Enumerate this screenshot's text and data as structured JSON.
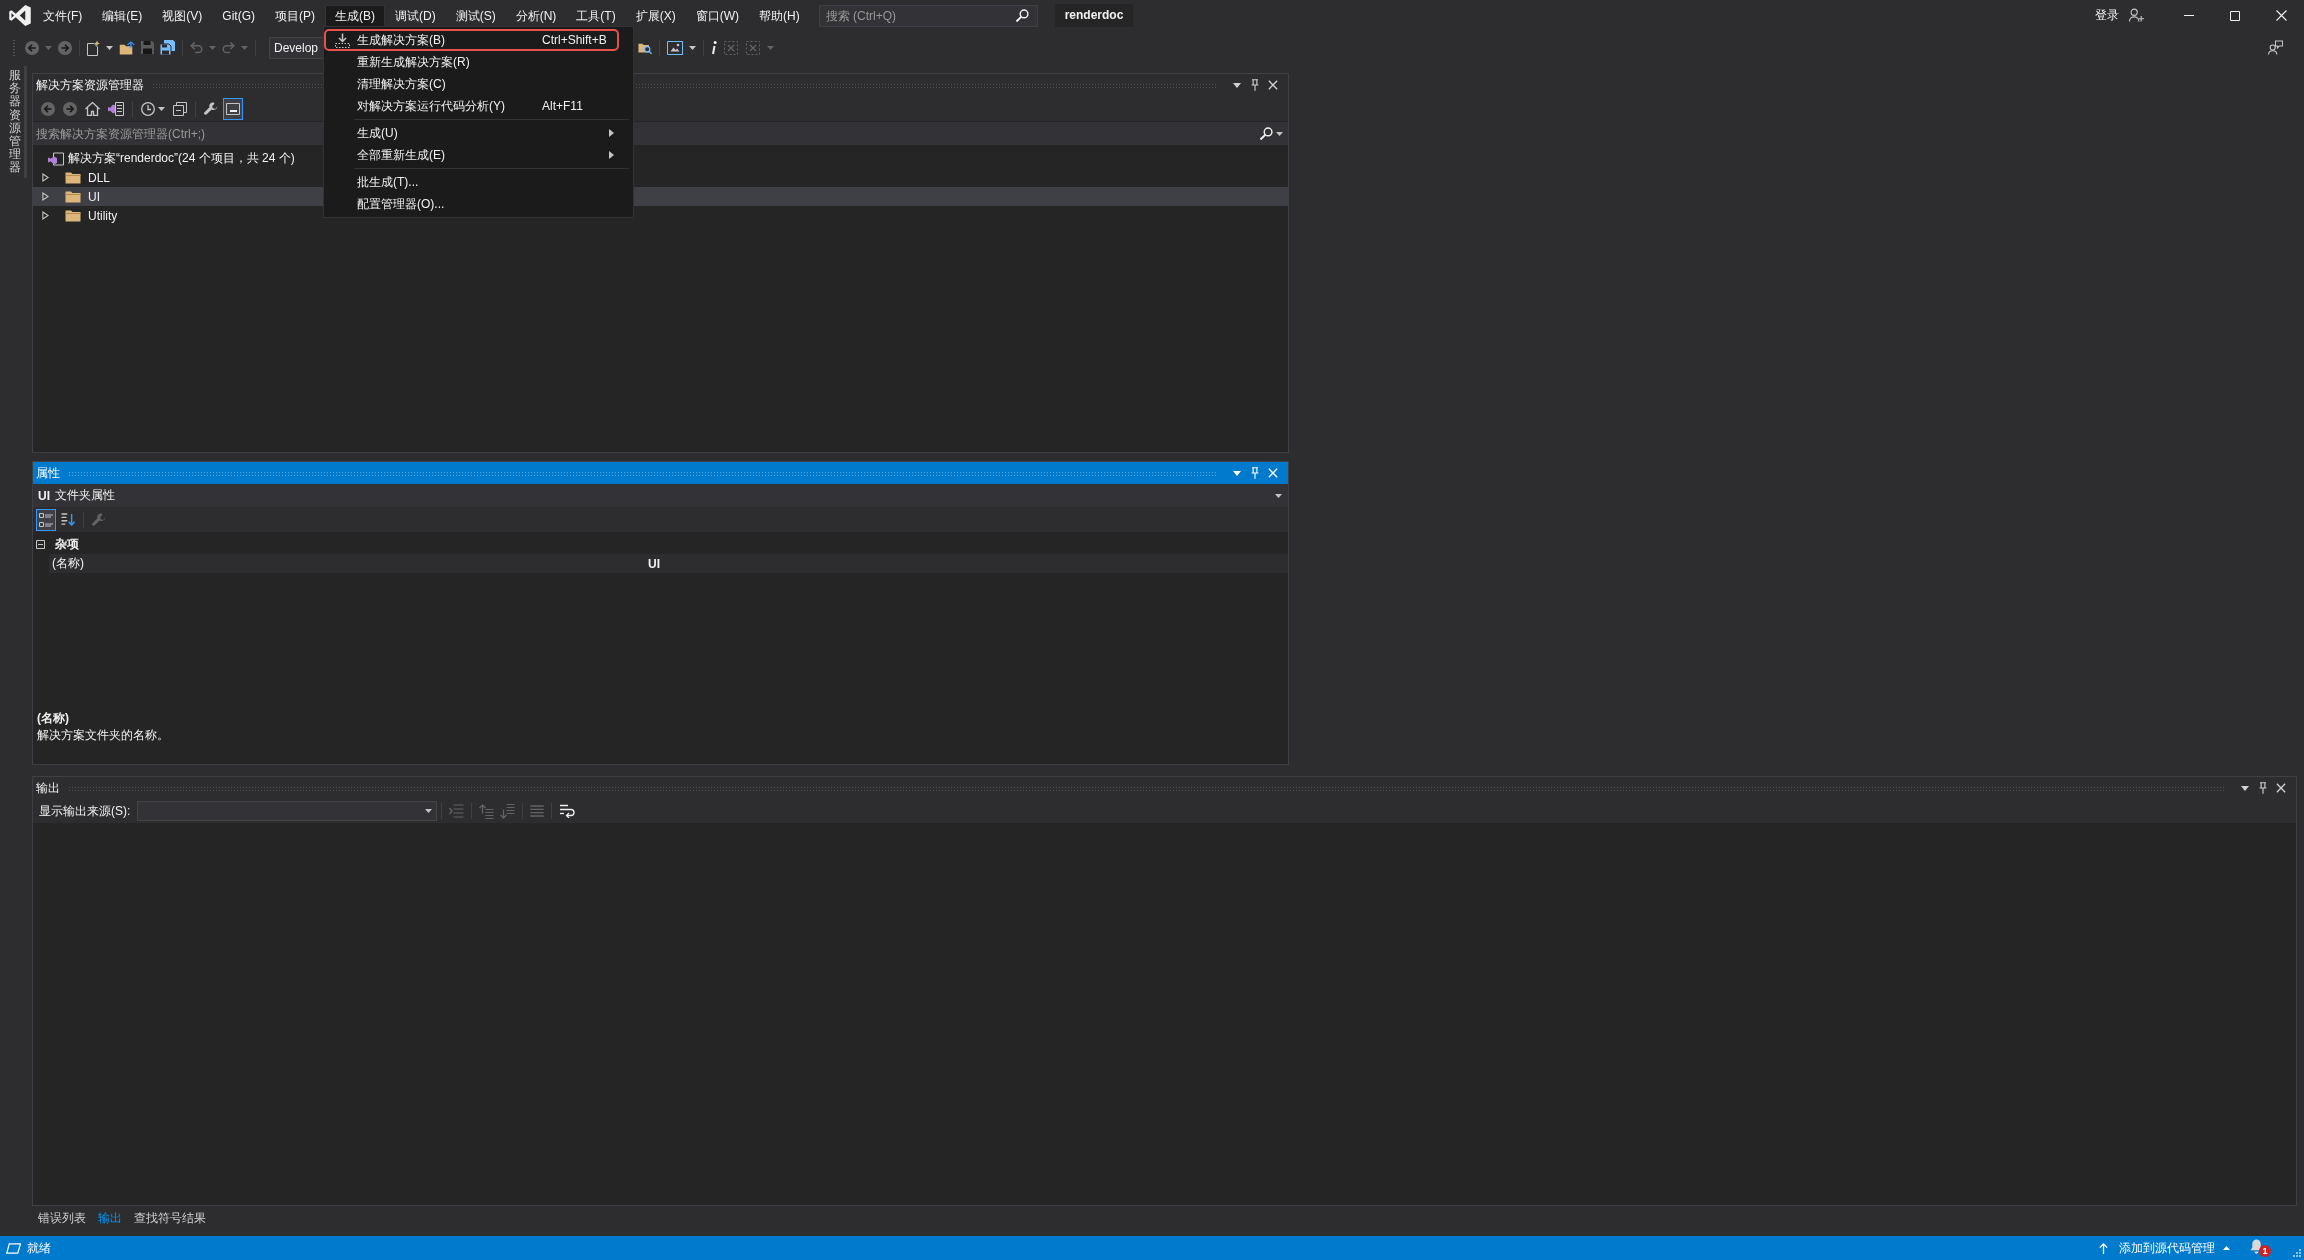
{
  "menu_bar": {
    "items": [
      {
        "label": "文件(F)",
        "selected": false
      },
      {
        "label": "编辑(E)",
        "selected": false
      },
      {
        "label": "视图(V)",
        "selected": false
      },
      {
        "label": "Git(G)",
        "selected": false
      },
      {
        "label": "项目(P)",
        "selected": false
      },
      {
        "label": "生成(B)",
        "selected": true
      },
      {
        "label": "调试(D)",
        "selected": false
      },
      {
        "label": "测试(S)",
        "selected": false
      },
      {
        "label": "分析(N)",
        "selected": false
      },
      {
        "label": "工具(T)",
        "selected": false
      },
      {
        "label": "扩展(X)",
        "selected": false
      },
      {
        "label": "窗口(W)",
        "selected": false
      },
      {
        "label": "帮助(H)",
        "selected": false
      }
    ],
    "search": {
      "placeholder": "搜索 (Ctrl+Q)"
    },
    "solution_name": "renderdoc",
    "sign_in": "登录"
  },
  "toolbar": {
    "groups": [
      {
        "buttons": [
          {
            "kind": "back",
            "disabled": true,
            "dropdown": true
          },
          {
            "kind": "forward",
            "disabled": true
          }
        ]
      },
      {
        "buttons": [
          {
            "kind": "new_item",
            "disabled": false,
            "dropdown": true
          },
          {
            "kind": "open",
            "disabled": false
          },
          {
            "kind": "save",
            "disabled": true
          },
          {
            "kind": "save_all",
            "disabled": false
          }
        ]
      },
      {
        "buttons": [
          {
            "kind": "undo",
            "disabled": true,
            "dropdown": true
          },
          {
            "kind": "redo",
            "disabled": true,
            "dropdown": true
          }
        ]
      }
    ],
    "configuration": "Develop",
    "groups_after": [
      {
        "buttons": [
          {
            "kind": "find_files",
            "disabled": false
          }
        ]
      },
      {
        "buttons": [
          {
            "kind": "screenshot",
            "disabled": false,
            "dropdown": true
          }
        ]
      },
      {
        "buttons": [
          {
            "kind": "info",
            "disabled": false
          },
          {
            "kind": "frame_select",
            "disabled": true
          },
          {
            "kind": "frame_fit",
            "disabled": true,
            "dropdown": true
          }
        ]
      }
    ]
  },
  "build_menu": {
    "groups": [
      {
        "items": [
          {
            "kind": "command",
            "label": "生成解决方案(B)",
            "shortcut": "Ctrl+Shift+B",
            "icon": true,
            "selected": true
          },
          {
            "kind": "command",
            "label": "重新生成解决方案(R)",
            "selected": false
          },
          {
            "kind": "command",
            "label": "清理解决方案(C)",
            "selected": false
          },
          {
            "kind": "command",
            "label": "对解决方案运行代码分析(Y)",
            "shortcut": "Alt+F11",
            "selected": false
          }
        ]
      },
      {
        "items": [
          {
            "kind": "submenu",
            "label": "生成(U)",
            "selected": false
          },
          {
            "kind": "submenu",
            "label": "全部重新生成(E)",
            "selected": false
          }
        ]
      },
      {
        "items": [
          {
            "kind": "command",
            "label": "批生成(T)...",
            "selected": false
          },
          {
            "kind": "command",
            "label": "配置管理器(O)...",
            "selected": false
          }
        ]
      }
    ]
  },
  "side_tab": {
    "label": "服务器资源管理器"
  },
  "solution_explorer": {
    "title": "解决方案资源管理器",
    "active": false,
    "toolbar": {
      "groups": [
        {
          "buttons": [
            {
              "kind": "back",
              "disabled": true,
              "on": false
            },
            {
              "kind": "forward",
              "disabled": true,
              "on": false
            },
            {
              "kind": "home",
              "disabled": false,
              "on": false
            },
            {
              "kind": "switch_views",
              "disabled": false,
              "on": false
            }
          ]
        },
        {
          "buttons": [
            {
              "kind": "pending_filter",
              "disabled": false,
              "on": false,
              "dropdown": true
            },
            {
              "kind": "collapse_all",
              "disabled": false,
              "on": false
            }
          ]
        },
        {
          "buttons": [
            {
              "kind": "properties",
              "disabled": false,
              "on": false
            },
            {
              "kind": "preview",
              "disabled": false,
              "on": true
            }
          ]
        }
      ]
    },
    "search": {
      "placeholder": "搜索解决方案资源管理器(Ctrl+;)"
    },
    "tree": {
      "kind": "solution",
      "label": "解决方案“renderdoc”(24 个项目，共 24 个)",
      "selected": false,
      "children": [
        {
          "kind": "folder",
          "label": "DLL",
          "expanded": false,
          "selected": false
        },
        {
          "kind": "folder",
          "label": "UI",
          "expanded": false,
          "selected": true
        },
        {
          "kind": "folder",
          "label": "Utility",
          "expanded": false,
          "selected": false
        }
      ]
    }
  },
  "properties": {
    "title": "属性",
    "active": true,
    "object": {
      "name": "UI",
      "type": "文件夹属性"
    },
    "toolbar": {
      "groups": [
        {
          "buttons": [
            {
              "kind": "categorized",
              "disabled": false,
              "on": true
            },
            {
              "kind": "alphabetical",
              "disabled": false,
              "on": false
            }
          ]
        },
        {
          "buttons": [
            {
              "kind": "property_pages",
              "disabled": true,
              "on": false
            }
          ]
        }
      ]
    },
    "categories": [
      {
        "label": "杂项",
        "expanded": true,
        "properties": [
          {
            "name": "(名称)",
            "value": "UI"
          }
        ]
      }
    ],
    "description": {
      "title": "(名称)",
      "text": "解决方案文件夹的名称。"
    }
  },
  "output": {
    "title": "输出",
    "active": false,
    "source_label": "显示输出来源(S):",
    "toolbar": {
      "groups": [
        {
          "buttons": [
            {
              "kind": "find_in_code",
              "disabled": true
            }
          ]
        },
        {
          "buttons": [
            {
              "kind": "prev_message",
              "disabled": true
            },
            {
              "kind": "next_message",
              "disabled": true
            }
          ]
        },
        {
          "buttons": [
            {
              "kind": "clear_all",
              "disabled": true
            }
          ]
        },
        {
          "buttons": [
            {
              "kind": "word_wrap",
              "disabled": false
            }
          ]
        }
      ]
    }
  },
  "bottom_tabs": [
    {
      "label": "错误列表",
      "selected": false
    },
    {
      "label": "输出",
      "selected": true
    },
    {
      "label": "查找符号结果",
      "selected": false
    }
  ],
  "status_bar": {
    "message": "就绪",
    "source_control": "添加到源代码管理",
    "notifications": "1"
  }
}
